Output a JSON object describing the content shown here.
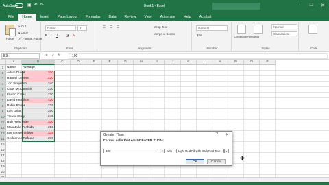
{
  "titlebar": {
    "autosave_label": "AutoSave",
    "autosave_state": "Off",
    "doc_title": "Book1 - Excel",
    "qat_icons": [
      "save-icon",
      "undo-icon",
      "redo-icon"
    ],
    "window_controls": [
      "minimize-icon",
      "restore-icon",
      "close-icon"
    ]
  },
  "tabs": [
    "File",
    "Home",
    "Insert",
    "Page Layout",
    "Formulas",
    "Data",
    "Review",
    "View",
    "Automate",
    "Help",
    "Acrobat"
  ],
  "active_tab": "Home",
  "ribbon": {
    "clipboard": {
      "paste": "Paste",
      "cut": "Cut",
      "copy": "Copy",
      "format_painter": "Format Painter",
      "label": "Clipboard"
    },
    "font": {
      "name": "Calibri",
      "size": "11",
      "label": "Font"
    },
    "alignment": {
      "wrap": "Wrap Text",
      "merge": "Merge & Center",
      "label": "Alignment"
    },
    "number": {
      "format": "General",
      "label": "Number"
    },
    "styles": {
      "conditional": "Conditional Formatting",
      "format_table": "Format as Table",
      "normal": "Normal",
      "bad": "Bad",
      "calculation": "Calculation",
      "check_cell": "Check Cell",
      "label": "Styles"
    },
    "cells": {
      "insert": "Insert",
      "label": "Cells"
    }
  },
  "formula_bar": {
    "name_box": "B3",
    "content": "100",
    "buttons": [
      "✕",
      "✓",
      "fx"
    ]
  },
  "columns": [
    "A",
    "B",
    "C",
    "D",
    "E",
    "F",
    "G",
    "H",
    "I",
    "J",
    "K",
    "L",
    "M",
    "N",
    "O",
    "P"
  ],
  "rows": [
    "1",
    "2",
    "3",
    "4",
    "5",
    "6",
    "7",
    "8",
    "9",
    "10",
    "11",
    "12",
    "13",
    "14",
    "15",
    "16",
    "17",
    "18",
    "19",
    "20",
    "21",
    "22"
  ],
  "table": {
    "header_name": "Name",
    "header_avg": "Average",
    "entries": [
      {
        "name": "Adam Duvall",
        "avg": "320",
        "highlight": true
      },
      {
        "name": "Raquel Devers",
        "avg": "230",
        "highlight": true
      },
      {
        "name": "Jon Singelton",
        "avg": "240",
        "highlight": false
      },
      {
        "name": "Chas McCormick",
        "avg": "230",
        "highlight": false
      },
      {
        "name": "Fruton Cates",
        "avg": "210",
        "highlight": false
      },
      {
        "name": "David Hamilton",
        "avg": "430",
        "highlight": true
      },
      {
        "name": "Pablo Reyes",
        "avg": "215",
        "highlight": false
      },
      {
        "name": "Luis Urias",
        "avg": "200",
        "highlight": false
      },
      {
        "name": "Trevor Story",
        "avg": "245",
        "highlight": false
      },
      {
        "name": "Rob Refsnyder",
        "avg": "330",
        "highlight": true
      },
      {
        "name": "Masataka Yoshida",
        "avg": "266",
        "highlight": false
      },
      {
        "name": "Emmanuel Valdez",
        "avg": "335",
        "highlight": true
      },
      {
        "name": "Ceddanne Rafaela",
        "avg": "270",
        "highlight": false
      }
    ]
  },
  "colors": {
    "excel_green": "#217346",
    "light_red_fill": "#ffc7ce",
    "dark_red_text": "#9c0006"
  },
  "dialog": {
    "title": "Greater Than",
    "help": "?",
    "close": "✕",
    "prompt": "Format cells that are GREATER THAN:",
    "value": "300",
    "with_label": "with",
    "format_option": "Light Red Fill with Dark Red Text",
    "ok_label": "OK",
    "cancel_label": "Cancel"
  }
}
